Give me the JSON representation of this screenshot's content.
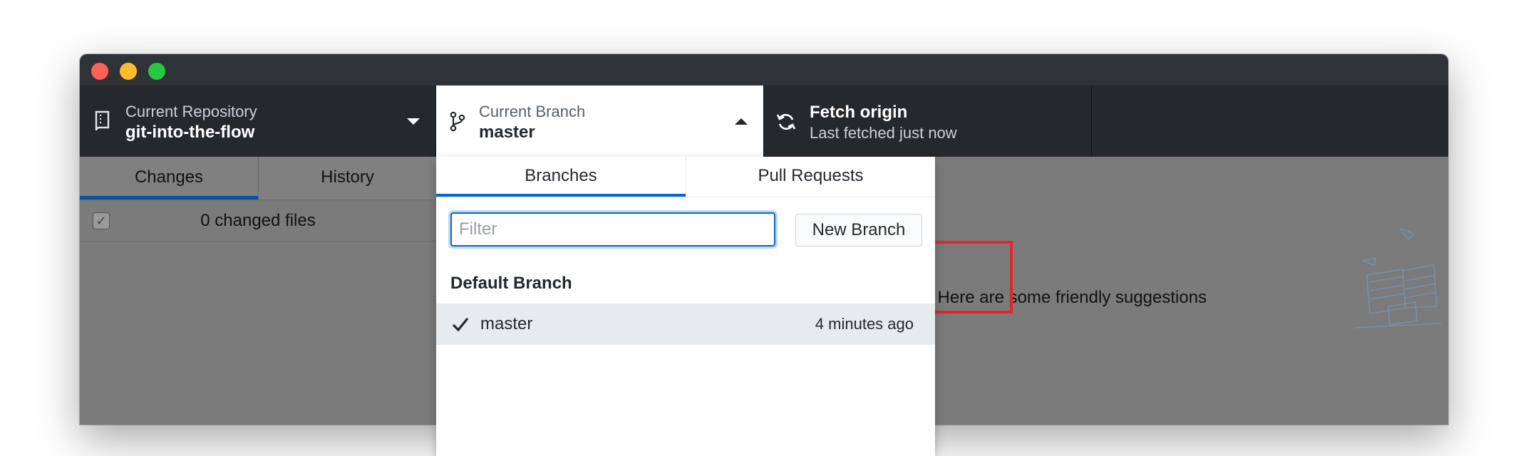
{
  "toolbar": {
    "repo_label": "Current Repository",
    "repo_value": "git-into-the-flow",
    "branch_label": "Current Branch",
    "branch_value": "master",
    "fetch_label": "Fetch origin",
    "fetch_value": "Last fetched just now"
  },
  "sidebar": {
    "tabs": [
      {
        "label": "Changes",
        "selected": true
      },
      {
        "label": "History",
        "selected": false
      }
    ],
    "changed_files": "0 changed files"
  },
  "main": {
    "suggestion_text": "y. Here are some friendly suggestions"
  },
  "branch_popover": {
    "tabs": [
      {
        "label": "Branches",
        "selected": true
      },
      {
        "label": "Pull Requests",
        "selected": false
      }
    ],
    "filter": {
      "placeholder": "Filter",
      "value": ""
    },
    "new_branch_label": "New Branch",
    "section_header": "Default Branch",
    "branches": [
      {
        "name": "master",
        "time": "4 minutes ago",
        "checked": true
      }
    ]
  },
  "colors": {
    "toolbar_bg": "#24292e",
    "accent_blue": "#0366d6",
    "highlight_red": "#e3262b"
  },
  "icons": [
    "repo-icon",
    "branch-icon",
    "caret-down-icon",
    "caret-up-icon",
    "sync-icon",
    "checkmark-icon",
    "check-icon"
  ]
}
